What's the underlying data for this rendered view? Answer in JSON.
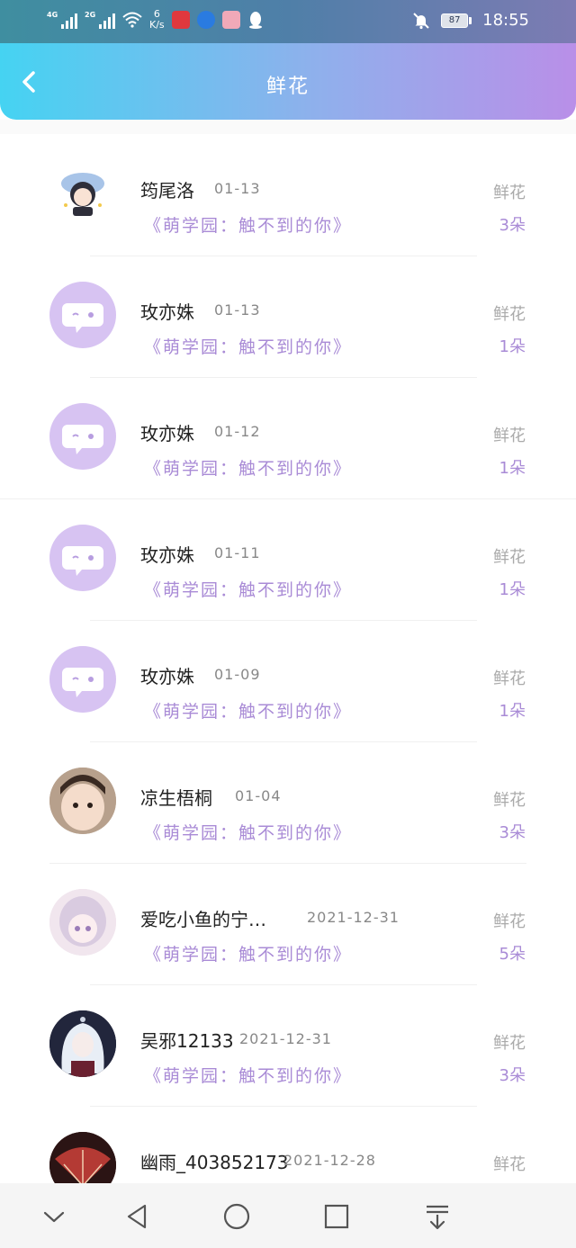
{
  "status_bar": {
    "net_4g": "4G",
    "net_2g": "2G",
    "speed_value": "6",
    "speed_unit": "K/s",
    "battery": "87",
    "time": "18:55"
  },
  "header": {
    "title": "鲜花",
    "back_icon": "chevron-left-icon"
  },
  "items": [
    {
      "name": "筠尾洛",
      "date": "01-13",
      "book": "《萌学园：触不到的你》",
      "gift": "鲜花",
      "count": "3朵",
      "avatar": "anime-character"
    },
    {
      "name": "玫亦姝",
      "date": "01-13",
      "book": "《萌学园：触不到的你》",
      "gift": "鲜花",
      "count": "1朵",
      "avatar": "default"
    },
    {
      "name": "玫亦姝",
      "date": "01-12",
      "book": "《萌学园：触不到的你》",
      "gift": "鲜花",
      "count": "1朵",
      "avatar": "default"
    },
    {
      "name": "玫亦姝",
      "date": "01-11",
      "book": "《萌学园：触不到的你》",
      "gift": "鲜花",
      "count": "1朵",
      "avatar": "default"
    },
    {
      "name": "玫亦姝",
      "date": "01-09",
      "book": "《萌学园：触不到的你》",
      "gift": "鲜花",
      "count": "1朵",
      "avatar": "default"
    },
    {
      "name": "凉生梧桐",
      "date": "01-04",
      "book": "《萌学园：触不到的你》",
      "gift": "鲜花",
      "count": "3朵",
      "avatar": "photo-child"
    },
    {
      "name": "爱吃小鱼的宁…",
      "date": "2021-12-31",
      "book": "《萌学园：触不到的你》",
      "gift": "鲜花",
      "count": "5朵",
      "avatar": "photo-anime-girl"
    },
    {
      "name": "吴邪12133",
      "date": "2021-12-31",
      "book": "《萌学园：触不到的你》",
      "gift": "鲜花",
      "count": "3朵",
      "avatar": "photo-anime-white-hair"
    },
    {
      "name": "幽雨_403852173",
      "date": "2021-12-28",
      "book": "",
      "gift": "鲜花",
      "count": "",
      "avatar": "photo-fan"
    }
  ],
  "navbar": {
    "icons": [
      "chevron-down-icon",
      "back-triangle-icon",
      "home-circle-icon",
      "recents-square-icon",
      "download-icon"
    ]
  }
}
